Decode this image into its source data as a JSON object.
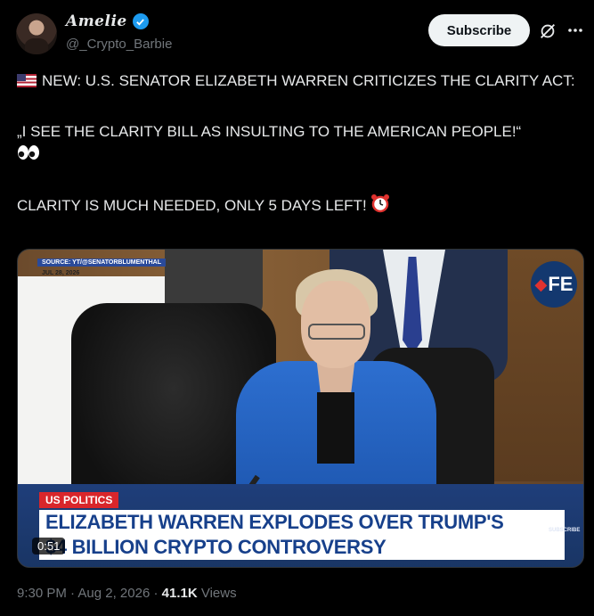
{
  "author": {
    "display_name": "Amelie",
    "handle": "@_Crypto_Barbie"
  },
  "actions": {
    "subscribe_label": "Subscribe"
  },
  "tweet": {
    "line1": "NEW: U.S. SENATOR ELIZABETH WARREN CRITICIZES THE CLARITY ACT:",
    "line2": "„I SEE THE CLARITY BILL AS INSULTING TO THE AMERICAN PEOPLE!“",
    "line3": "CLARITY IS MUCH NEEDED, ONLY 5 DAYS LEFT!"
  },
  "video": {
    "source": "SOURCE: YT/@SENATORBLUMENTHAL",
    "date": "JUL 28, 2026",
    "network_logo": "FE",
    "category_tag": "US POLITICS",
    "headline_line1": "ELIZABETH WARREN EXPLODES OVER TRUMP'S",
    "headline_line2": "$4 BILLION CRYPTO CONTROVERSY",
    "subscribe_mini": "SUBSCRIBE",
    "duration": "0:51"
  },
  "meta": {
    "time": "9:30 PM",
    "separator": "·",
    "date": "Aug 2, 2026",
    "views_count": "41.1K",
    "views_label": "Views"
  },
  "colors": {
    "verified": "#1d9bf0",
    "headline_text": "#17408b",
    "tag_red": "#d9262b"
  },
  "icons": [
    "verified-badge-icon",
    "grok-icon",
    "more-icon",
    "us-flag-icon",
    "eyes-icon",
    "alarm-clock-icon"
  ]
}
